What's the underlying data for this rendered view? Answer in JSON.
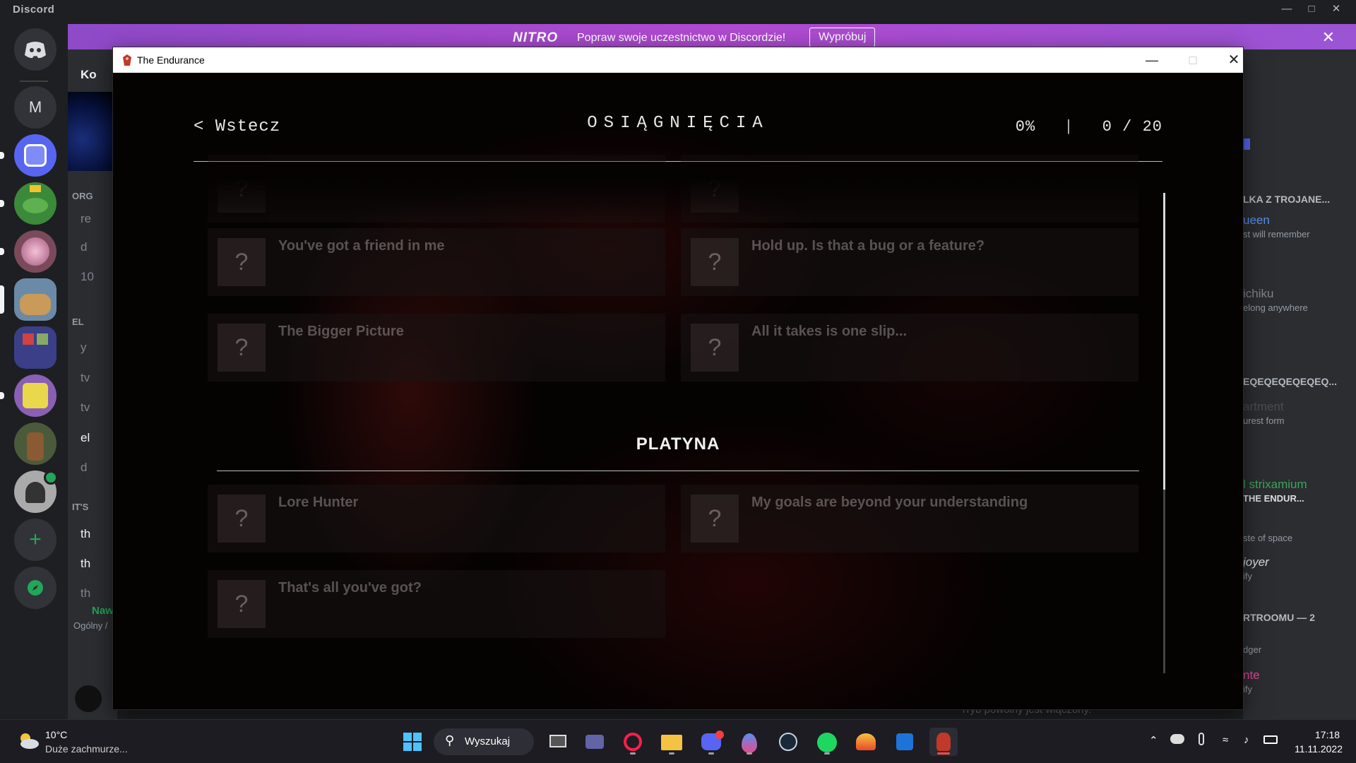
{
  "discord": {
    "title": "Discord",
    "rail": {
      "dm_letter": "M"
    },
    "nitro": {
      "logo": "NITRO",
      "text": "Popraw swoje uczestnictwo w Discordzie!",
      "button": "Wypróbuj"
    },
    "channels": {
      "server_name": "Ko",
      "category1": "ORG",
      "ch1": "re",
      "ch2": "d",
      "ch3": "10",
      "category2": "EL",
      "ch4": "y",
      "ch5": "tv",
      "ch6": "tv",
      "ch7": "el",
      "ch8": "d",
      "category3": "IT'S",
      "ch9": "th",
      "ch10": "th",
      "ch11": "th",
      "voice_status": "Naw",
      "voice_sub": "Ogólny /"
    },
    "members": {
      "l1": "LKA Z TROJANE...",
      "l2": "ueen",
      "l3": "st will remember",
      "l4": "ichiku",
      "l5": "elong anywhere",
      "l6": "EQEQEQEQEQEQ...",
      "l7": "artment",
      "l8": "urest form",
      "l9": "l strixamium",
      "l10": "THE ENDUR...",
      "l11": "ste of space",
      "l12": "joyer",
      "l13": "ify",
      "l14": "RTROOMU — 2",
      "l15": "dger",
      "l16": "nte",
      "l17": "ify"
    },
    "footer_hint": "Tryb powolny jest włączony."
  },
  "game": {
    "window_title": "The Endurance",
    "back": "< Wstecz",
    "heading": "OSIĄGNIĘCIA",
    "percent": "0%",
    "divider": "|",
    "count": "0 / 20",
    "placeholder_glyph": "?",
    "top_cards": [
      {
        "title": "You've got a friend in me"
      },
      {
        "title": "Hold up. Is that a bug or a feature?"
      },
      {
        "title": "The Bigger Picture"
      },
      {
        "title": "All it takes is one slip..."
      }
    ],
    "section": "PLATYNA",
    "platinum_cards": [
      {
        "title": "Lore Hunter"
      },
      {
        "title": "My goals are beyond your understanding"
      },
      {
        "title": "That's all you've got?"
      }
    ]
  },
  "taskbar": {
    "temperature": "10°C",
    "condition": "Duże zachmurze...",
    "search": "Wyszukaj",
    "time": "17:18",
    "date": "11.11.2022"
  },
  "colors": {
    "nitro_gradient": "#b04ad1",
    "game_bg": "#050202",
    "accent_red": "#c0392b",
    "discord_green": "#23a55a"
  }
}
